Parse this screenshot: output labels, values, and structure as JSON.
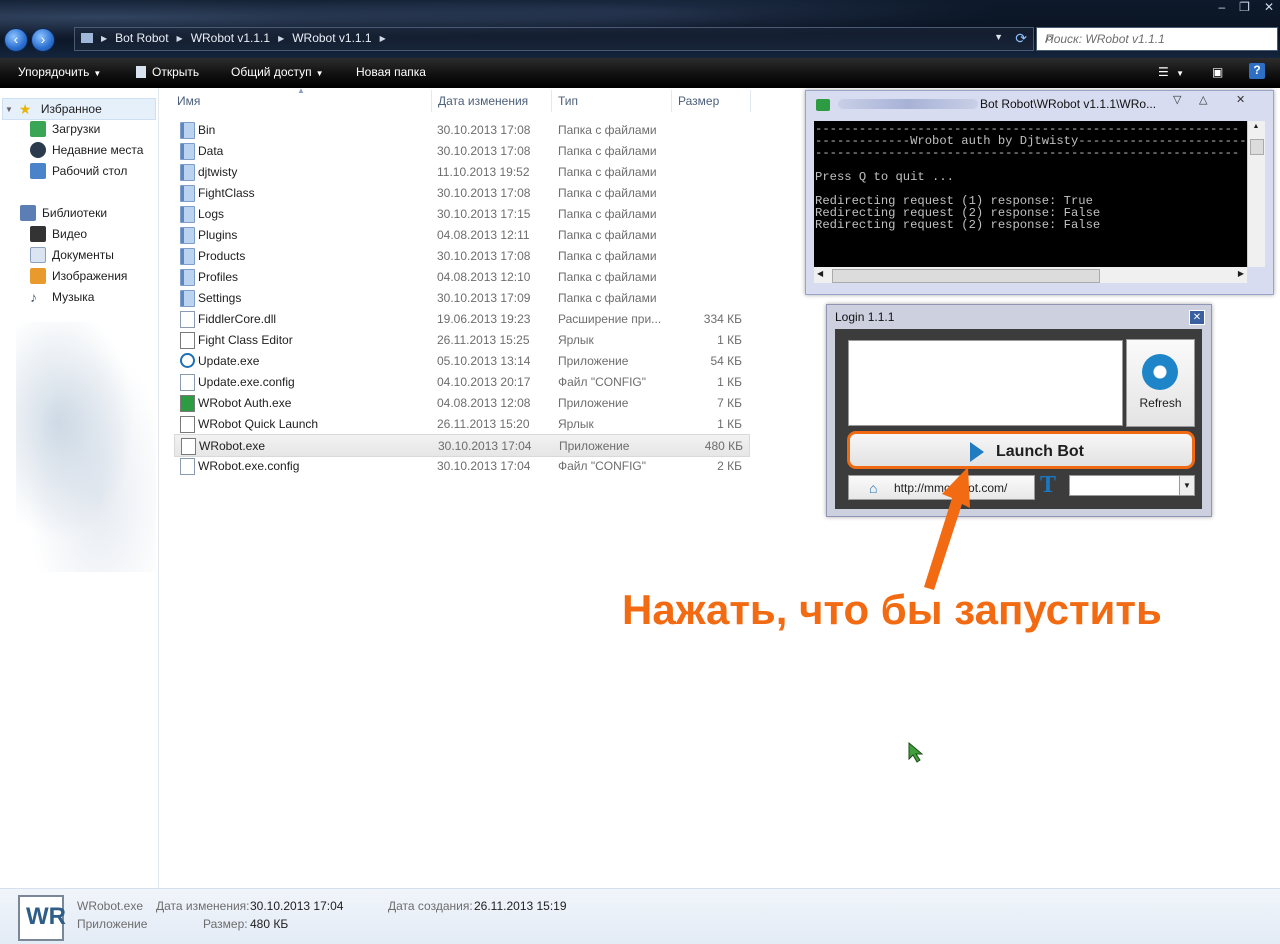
{
  "titlebar": {
    "window_controls": [
      "‒",
      "❐",
      "✕"
    ]
  },
  "address": {
    "crumbs": [
      "Bot Robot",
      "WRobot v1.1.1",
      "WRobot v1.1.1"
    ]
  },
  "search": {
    "placeholder": "Поиск: WRobot v1.1.1"
  },
  "toolbar": {
    "organize": "Упорядочить",
    "open": "Открыть",
    "share": "Общий доступ",
    "new_folder": "Новая папка"
  },
  "sidebar": {
    "favorites": "Избранное",
    "fav_items": [
      "Загрузки",
      "Недавние места",
      "Рабочий стол"
    ],
    "libraries": "Библиотеки",
    "lib_items": [
      "Видео",
      "Документы",
      "Изображения",
      "Музыка"
    ]
  },
  "columns": {
    "name": "Имя",
    "date": "Дата изменения",
    "type": "Тип",
    "size": "Размер"
  },
  "files": [
    {
      "name": "Bin",
      "date": "30.10.2013 17:08",
      "type": "Папка с файлами",
      "size": "",
      "icon": "folder"
    },
    {
      "name": "Data",
      "date": "30.10.2013 17:08",
      "type": "Папка с файлами",
      "size": "",
      "icon": "folder"
    },
    {
      "name": "djtwisty",
      "date": "11.10.2013 19:52",
      "type": "Папка с файлами",
      "size": "",
      "icon": "folder"
    },
    {
      "name": "FightClass",
      "date": "30.10.2013 17:08",
      "type": "Папка с файлами",
      "size": "",
      "icon": "folder"
    },
    {
      "name": "Logs",
      "date": "30.10.2013 17:15",
      "type": "Папка с файлами",
      "size": "",
      "icon": "folder"
    },
    {
      "name": "Plugins",
      "date": "04.08.2013 12:11",
      "type": "Папка с файлами",
      "size": "",
      "icon": "folder"
    },
    {
      "name": "Products",
      "date": "30.10.2013 17:08",
      "type": "Папка с файлами",
      "size": "",
      "icon": "folder"
    },
    {
      "name": "Profiles",
      "date": "04.08.2013 12:10",
      "type": "Папка с файлами",
      "size": "",
      "icon": "folder"
    },
    {
      "name": "Settings",
      "date": "30.10.2013 17:09",
      "type": "Папка с файлами",
      "size": "",
      "icon": "folder"
    },
    {
      "name": "FiddlerCore.dll",
      "date": "19.06.2013 19:23",
      "type": "Расширение при...",
      "size": "334 КБ",
      "icon": "dll"
    },
    {
      "name": "Fight Class Editor",
      "date": "26.11.2013 15:25",
      "type": "Ярлык",
      "size": "1 КБ",
      "icon": "app"
    },
    {
      "name": "Update.exe",
      "date": "05.10.2013 13:14",
      "type": "Приложение",
      "size": "54 КБ",
      "icon": "update"
    },
    {
      "name": "Update.exe.config",
      "date": "04.10.2013 20:17",
      "type": "Файл \"CONFIG\"",
      "size": "1 КБ",
      "icon": "doc"
    },
    {
      "name": "WRobot Auth.exe",
      "date": "04.08.2013 12:08",
      "type": "Приложение",
      "size": "7 КБ",
      "icon": "auth"
    },
    {
      "name": "WRobot Quick Launch",
      "date": "26.11.2013 15:20",
      "type": "Ярлык",
      "size": "1 КБ",
      "icon": "app"
    },
    {
      "name": "WRobot.exe",
      "date": "30.10.2013 17:04",
      "type": "Приложение",
      "size": "480 КБ",
      "icon": "app",
      "selected": true
    },
    {
      "name": "WRobot.exe.config",
      "date": "30.10.2013 17:04",
      "type": "Файл \"CONFIG\"",
      "size": "2 КБ",
      "icon": "doc"
    }
  ],
  "status": {
    "icon_text": "WR",
    "name": "WRobot.exe",
    "kind": "Приложение",
    "modified_label": "Дата изменения:",
    "modified_value": "30.10.2013 17:04",
    "size_label": "Размер:",
    "size_value": "480 КБ",
    "created_label": "Дата создания:",
    "created_value": "26.11.2013 15:19"
  },
  "console": {
    "title": "Bot Robot\\WRobot v1.1.1\\WRo...",
    "lines": [
      "----------------------------------------------------------",
      "-------------Wrobot auth by Djtwisty-----------------------",
      "----------------------------------------------------------",
      "",
      "Press Q to quit ...",
      "",
      "Redirecting request (1) response: True",
      "Redirecting request (2) response: False",
      "Redirecting request (2) response: False"
    ]
  },
  "login": {
    "title": "Login 1.1.1",
    "refresh": "Refresh",
    "launch": "Launch Bot",
    "url": "http://mmorobot.com/",
    "t_icon": "T"
  },
  "annotation": {
    "text": "Нажать, что бы запустить",
    "color": "#f26b12"
  }
}
